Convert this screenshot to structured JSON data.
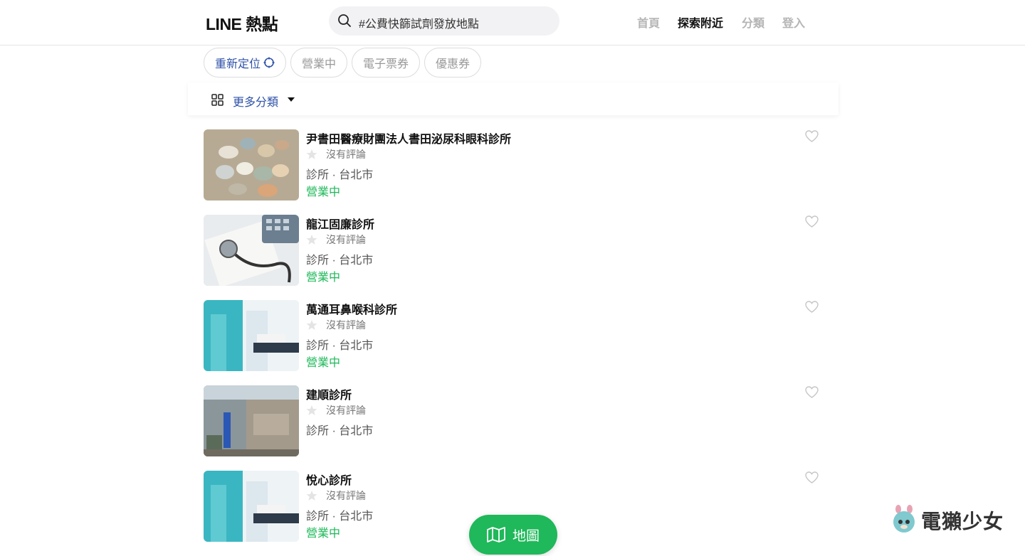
{
  "header": {
    "logo": "LINE 熱點",
    "search_placeholder": "#公費快篩試劑發放地點",
    "nav": [
      "首頁",
      "探索附近",
      "分類",
      "登入"
    ]
  },
  "filters": {
    "relocate": "重新定位",
    "open_now": "營業中",
    "e_ticket": "電子票券",
    "coupon": "優惠券"
  },
  "category_bar": {
    "label": "更多分類"
  },
  "results": [
    {
      "name": "尹書田醫療財團法人書田泌尿科眼科診所",
      "rating": "沒有評論",
      "meta": "診所 · 台北市",
      "status": "營業中"
    },
    {
      "name": "龍江固廉診所",
      "rating": "沒有評論",
      "meta": "診所 · 台北市",
      "status": "營業中"
    },
    {
      "name": "萬通耳鼻喉科診所",
      "rating": "沒有評論",
      "meta": "診所 · 台北市",
      "status": "營業中"
    },
    {
      "name": "建順診所",
      "rating": "沒有評論",
      "meta": "診所 · 台北市",
      "status": ""
    },
    {
      "name": "悅心診所",
      "rating": "沒有評論",
      "meta": "診所 · 台北市",
      "status": "營業中"
    }
  ],
  "map_button": "地圖",
  "watermark": "電獺少女",
  "colors": {
    "green": "#1fb85a",
    "blue": "#2f52a8",
    "muted": "#b5b5b5"
  }
}
